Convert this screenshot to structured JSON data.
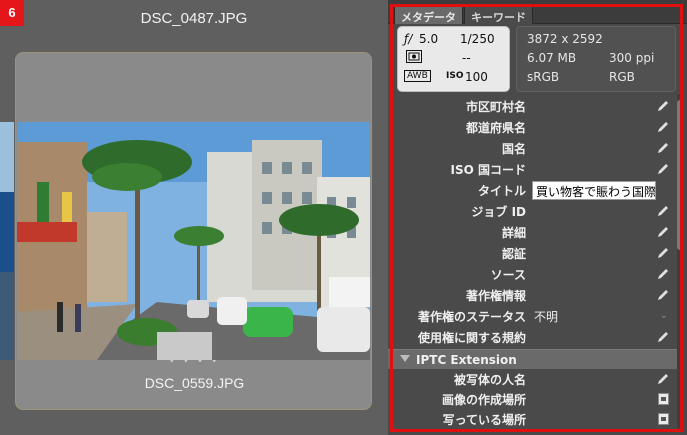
{
  "step_badge": "6",
  "filmstrip": {
    "top_filename": "DSC_0487.JPG",
    "selected_filename": "DSC_0559.JPG",
    "dots": "• • • •"
  },
  "panel": {
    "tabs": [
      "メタデータ",
      "キーワード"
    ],
    "camera": {
      "aperture": "5.0",
      "shutter": "1/250",
      "metering": "--",
      "iso": "100",
      "awb": "AWB"
    },
    "file_info": {
      "dimensions": "3872 x 2592",
      "size": "6.07 MB",
      "resolution": "300 ppi",
      "color_profile": "sRGB",
      "color_mode": "RGB"
    },
    "fields": [
      {
        "label": "市区町村名",
        "value": ""
      },
      {
        "label": "都道府県名",
        "value": ""
      },
      {
        "label": "国名",
        "value": ""
      },
      {
        "label": "ISO 国コード",
        "value": ""
      },
      {
        "label": "タイトル",
        "value": "買い物客で賑わう国際"
      },
      {
        "label": "ジョブ ID",
        "value": ""
      },
      {
        "label": "詳細",
        "value": ""
      },
      {
        "label": "認証",
        "value": ""
      },
      {
        "label": "ソース",
        "value": ""
      },
      {
        "label": "著作権情報",
        "value": ""
      },
      {
        "label": "著作権のステータス",
        "value": "不明"
      },
      {
        "label": "使用権に関する規約",
        "value": ""
      }
    ],
    "section_title": "IPTC Extension",
    "ext_fields": [
      {
        "label": "被写体の人名"
      },
      {
        "label": "画像の作成場所"
      },
      {
        "label": "写っている場所"
      }
    ]
  },
  "colors": {
    "highlight": "#e01010",
    "badge": "#e4161a"
  }
}
